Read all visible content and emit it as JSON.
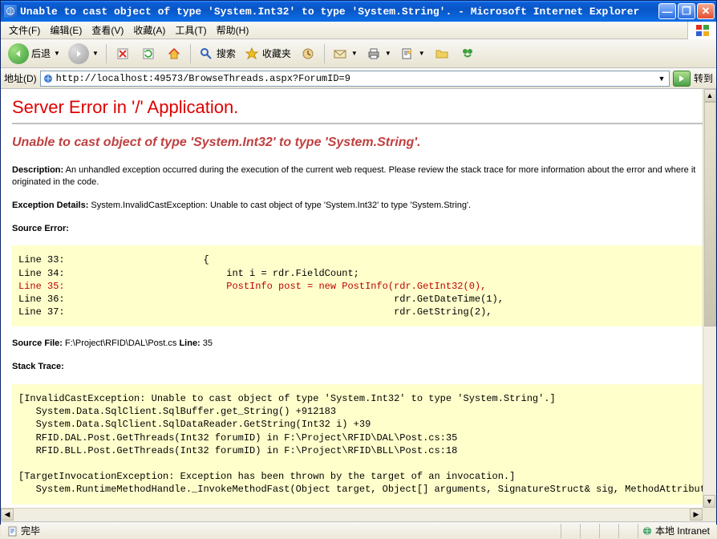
{
  "window": {
    "title": "Unable to cast object of type 'System.Int32' to type 'System.String'. - Microsoft Internet Explorer"
  },
  "menu": {
    "file": "文件(F)",
    "edit": "编辑(E)",
    "view": "查看(V)",
    "favorites": "收藏(A)",
    "tools": "工具(T)",
    "help": "帮助(H)"
  },
  "toolbar": {
    "back": "后退",
    "search": "搜索",
    "favorites": "收藏夹"
  },
  "address": {
    "label": "地址(D)",
    "url": "http://localhost:49573/BrowseThreads.aspx?ForumID=9",
    "go": "转到"
  },
  "error": {
    "h1": "Server Error in '/' Application.",
    "h2": "Unable to cast object of type 'System.Int32' to type 'System.String'.",
    "desc_label": "Description:",
    "desc_text": " An unhandled exception occurred during the execution of the current web request. Please review the stack trace for more information about the error and where it originated in the code.",
    "exc_label": "Exception Details:",
    "exc_text": " System.InvalidCastException: Unable to cast object of type 'System.Int32' to type 'System.String'.",
    "src_err_label": "Source Error:",
    "code": {
      "l33": "Line 33:                        {",
      "l34": "Line 34:                            int i = rdr.FieldCount;",
      "l35": "Line 35:                            PostInfo post = new PostInfo(rdr.GetInt32(0),",
      "l36": "Line 36:                                                         rdr.GetDateTime(1),",
      "l37": "Line 37:                                                         rdr.GetString(2),"
    },
    "src_file_label": "Source File:",
    "src_file": " F:\\Project\\RFID\\DAL\\Post.cs",
    "line_label": "    Line:",
    "line_num": " 35",
    "stack_label": "Stack Trace:",
    "stack": "[InvalidCastException: Unable to cast object of type 'System.Int32' to type 'System.String'.]\n   System.Data.SqlClient.SqlBuffer.get_String() +912183\n   System.Data.SqlClient.SqlDataReader.GetString(Int32 i) +39\n   RFID.DAL.Post.GetThreads(Int32 forumID) in F:\\Project\\RFID\\DAL\\Post.cs:35\n   RFID.BLL.Post.GetThreads(Int32 forumID) in F:\\Project\\RFID\\BLL\\Post.cs:18\n\n[TargetInvocationException: Exception has been thrown by the target of an invocation.]\n   System.RuntimeMethodHandle._InvokeMethodFast(Object target, Object[] arguments, SignatureStruct& sig, MethodAttributes"
  },
  "status": {
    "done": "完毕",
    "zone": "本地 Intranet"
  }
}
